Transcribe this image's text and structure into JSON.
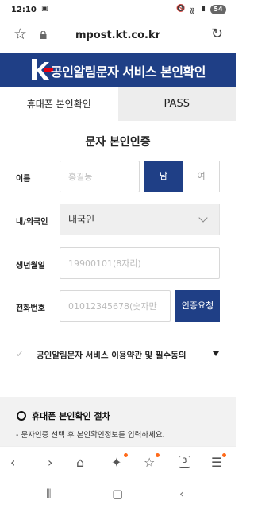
{
  "status": {
    "time": "12:10",
    "battery": "54"
  },
  "browser": {
    "url": "mpost.kt.co.kr"
  },
  "header": {
    "logo_text": "kt",
    "title": "공인알림문자 서비스 본인확인"
  },
  "tabs": [
    {
      "label": "휴대폰 본인확인"
    },
    {
      "label": "PASS"
    }
  ],
  "form": {
    "title": "문자 본인인증",
    "name": {
      "label": "이름",
      "placeholder": "홍길동"
    },
    "gender": {
      "male": "남",
      "female": "여"
    },
    "nationality": {
      "label": "내/외국인",
      "value": "내국인"
    },
    "birth": {
      "label": "생년월일",
      "placeholder": "19900101(8자리)"
    },
    "phone": {
      "label": "전화번호",
      "placeholder": "01012345678(숫자만"
    },
    "verify_button": "인증요청"
  },
  "agreement": {
    "text": "공인알림문자 서비스 이용약관 및 필수동의"
  },
  "procedure": {
    "title": "휴대폰 본인확인 절차",
    "desc": "- 문자인증 선택 후 본인확인정보를 입력하세요."
  },
  "bottom_nav": {
    "tab_count": "3"
  },
  "colors": {
    "brand": "#1f3f86",
    "accent_dot": "#ff6a1a"
  }
}
